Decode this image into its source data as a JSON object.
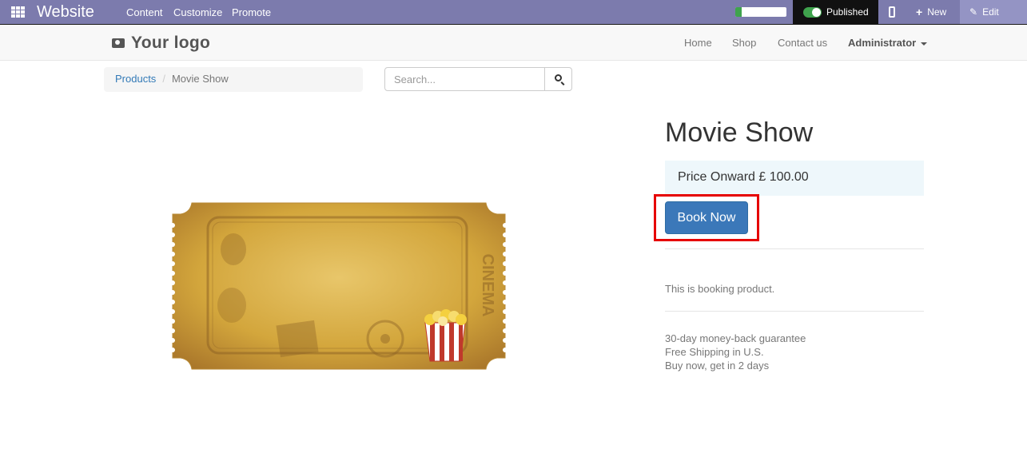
{
  "adminbar": {
    "brand": "Website",
    "menus": [
      "Content",
      "Customize",
      "Promote"
    ],
    "progress_fraction": 0.12,
    "published_label": "Published",
    "new_label": "New",
    "edit_label": "Edit"
  },
  "navbar": {
    "logo_text": "Your logo",
    "links": [
      "Home",
      "Shop",
      "Contact us"
    ],
    "user": "Administrator"
  },
  "breadcrumb": {
    "parent": "Products",
    "current": "Movie Show"
  },
  "search": {
    "placeholder": "Search..."
  },
  "product": {
    "title": "Movie Show",
    "price_text": "Price Onward £ 100.00",
    "book_label": "Book Now",
    "description": "This is booking product.",
    "perks": [
      "30-day money-back guarantee",
      "Free Shipping in U.S.",
      "Buy now, get in 2 days"
    ],
    "image_text": "CINEMA"
  },
  "colors": {
    "adminbar": "#7c7bad",
    "primary_button": "#3b78b9",
    "highlight": "#e60000",
    "published_toggle": "#3fa34d"
  }
}
